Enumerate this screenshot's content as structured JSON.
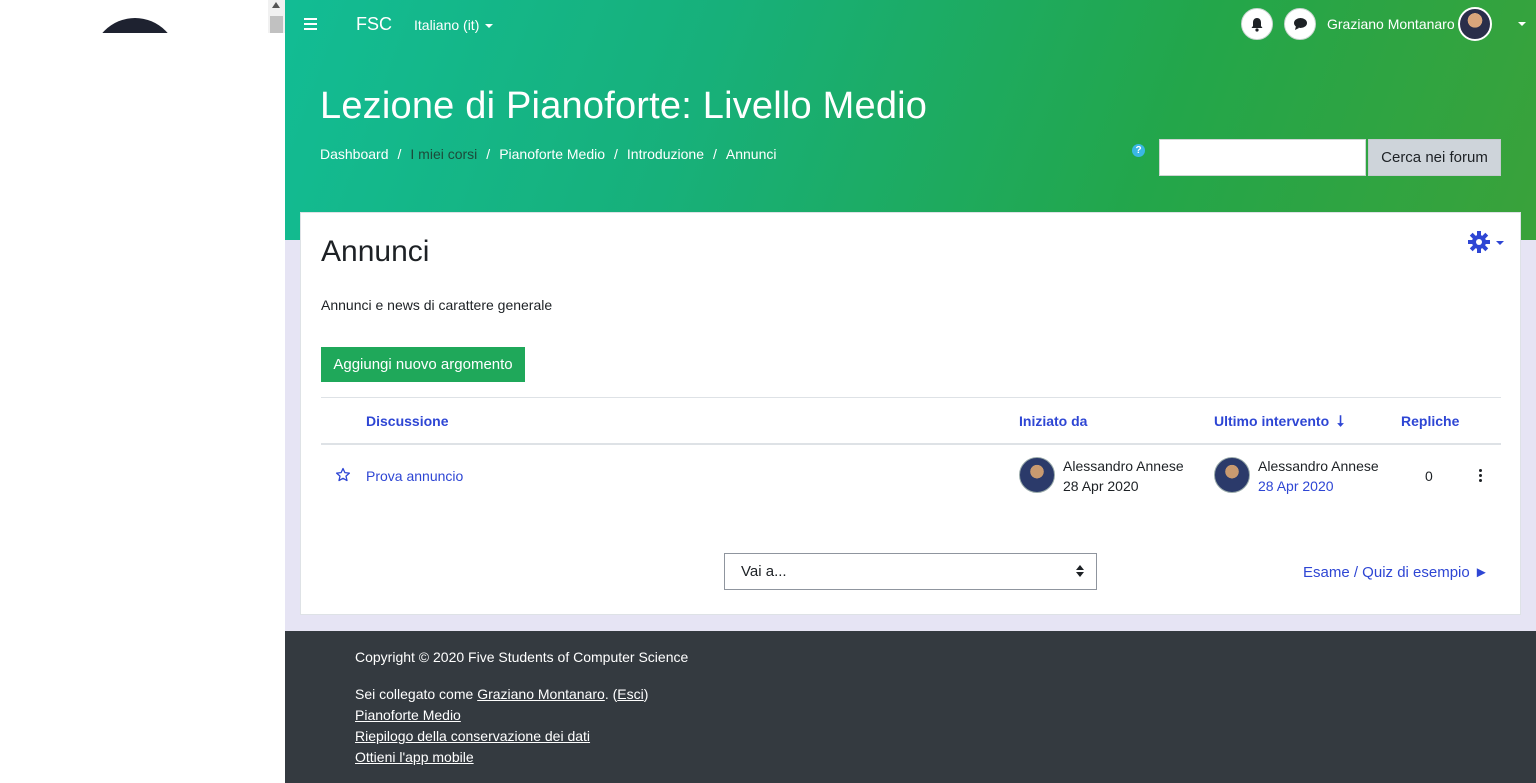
{
  "navbar": {
    "brand": "FSC",
    "language": "Italiano (it)",
    "user_name": "Graziano Montanaro"
  },
  "header": {
    "course_title": "Lezione di Pianoforte: Livello Medio",
    "breadcrumb": [
      "Dashboard",
      "I miei corsi",
      "Pianoforte Medio",
      "Introduzione",
      "Annunci"
    ],
    "search_button": "Cerca nei forum",
    "search_value": ""
  },
  "forum": {
    "title": "Annunci",
    "description": "Annunci e news di carattere generale",
    "add_button": "Aggiungi nuovo argomento",
    "columns": {
      "discussion": "Discussione",
      "started_by": "Iniziato da",
      "last_post": "Ultimo intervento",
      "replies": "Repliche"
    },
    "rows": [
      {
        "title": "Prova annuncio",
        "started_by_name": "Alessandro Annese",
        "started_date": "28 Apr 2020",
        "last_post_name": "Alessandro Annese",
        "last_post_date": "28 Apr 2020",
        "replies": "0"
      }
    ],
    "jump_to": "Vai a...",
    "next_activity": "Esame / Quiz di esempio ►"
  },
  "footer": {
    "copyright": "Copyright © 2020 Five Students of Computer Science",
    "logged_prefix": "Sei collegato come ",
    "logged_user": "Graziano Montanaro",
    "logged_mid": ". (",
    "logout": "Esci",
    "logged_suffix": ")",
    "links": [
      "Pianoforte Medio",
      "Riepilogo della conservazione dei dati",
      "Ottieni l'app mobile"
    ]
  },
  "colors": {
    "header_gradient_start": "#0fc4a5",
    "header_gradient_end": "#3aa23a",
    "link": "#2e46d4",
    "primary_button": "#1fa85a",
    "footer_bg": "#343a40",
    "page_bg": "#e6e4f4"
  },
  "icons": [
    "hamburger-icon",
    "bell-icon",
    "chat-icon",
    "help-icon",
    "gear-icon",
    "star-icon",
    "kebab-icon",
    "sort-down-icon",
    "updown-icon"
  ]
}
